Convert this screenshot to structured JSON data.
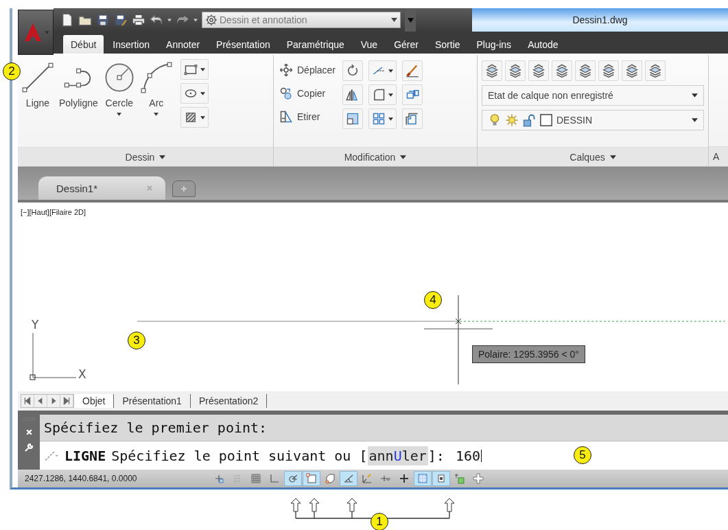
{
  "quick_access": {
    "workspace": "Dessin et annotation"
  },
  "window": {
    "title": "Dessin1.dwg"
  },
  "ribbon_tabs": [
    {
      "label": "Début",
      "selected": true
    },
    {
      "label": "Insertion",
      "selected": false
    },
    {
      "label": "Annoter",
      "selected": false
    },
    {
      "label": "Présentation",
      "selected": false
    },
    {
      "label": "Paramétrique",
      "selected": false
    },
    {
      "label": "Vue",
      "selected": false
    },
    {
      "label": "Gérer",
      "selected": false
    },
    {
      "label": "Sortie",
      "selected": false
    },
    {
      "label": "Plug-ins",
      "selected": false
    },
    {
      "label": "Autode",
      "selected": false
    }
  ],
  "draw_panel": {
    "title": "Dessin",
    "tools": [
      {
        "label": "Ligne",
        "dropdown": false
      },
      {
        "label": "Polyligne",
        "dropdown": false
      },
      {
        "label": "Cercle",
        "dropdown": true
      },
      {
        "label": "Arc",
        "dropdown": true
      }
    ]
  },
  "modify_panel": {
    "title": "Modification",
    "tools": [
      {
        "label": "Déplacer"
      },
      {
        "label": "Copier"
      },
      {
        "label": "Etirer"
      }
    ]
  },
  "layers_panel": {
    "title": "Calques",
    "layer_state": "Etat de calque non enregistré",
    "current_layer": "DESSIN"
  },
  "next_panel": {
    "title": "A"
  },
  "doc_tabs": [
    {
      "label": "Dessin1*"
    }
  ],
  "viewport_label": "[−][Haut][Filaire 2D]",
  "ucs": {
    "y": "Y",
    "x": "X"
  },
  "tooltip": "Polaire: 1295.3956 < 0°",
  "layout_tabs": [
    {
      "label": "Objet",
      "selected": true
    },
    {
      "label": "Présentation1",
      "selected": false
    },
    {
      "label": "Présentation2",
      "selected": false
    }
  ],
  "command_history": "Spécifiez le premier point:",
  "command_line": {
    "command": "LIGNE",
    "prompt": "Spécifiez le point suivant ou [",
    "option_pre": "ann",
    "option_key": "U",
    "option_post": "ler",
    "suffix": "]:",
    "value": "160"
  },
  "status_bar": {
    "coordinates": "2427.1286, 1440.6841, 0.0000",
    "toggles": [
      {
        "on": false
      },
      {
        "on": false
      },
      {
        "on": false
      },
      {
        "on": false
      },
      {
        "on": true
      },
      {
        "on": true
      },
      {
        "on": false
      },
      {
        "on": true
      },
      {
        "on": false
      },
      {
        "on": false
      },
      {
        "on": false
      },
      {
        "on": true
      },
      {
        "on": true
      },
      {
        "on": false
      },
      {
        "on": false
      }
    ]
  },
  "callouts": [
    "1",
    "2",
    "3",
    "4",
    "5"
  ]
}
